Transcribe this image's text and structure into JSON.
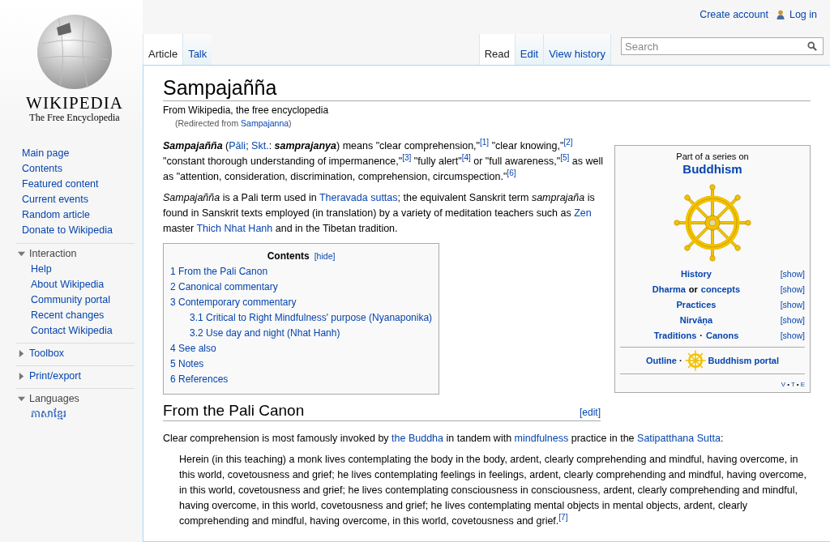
{
  "personal": {
    "create_account": "Create account",
    "log_in": "Log in"
  },
  "logo": {
    "wordmark": "WIKIPEDIA",
    "tagline": "The Free Encyclopedia"
  },
  "nav": [
    "Main page",
    "Contents",
    "Featured content",
    "Current events",
    "Random article",
    "Donate to Wikipedia"
  ],
  "portals": [
    {
      "title": "Interaction",
      "expanded": true,
      "items": [
        "Help",
        "About Wikipedia",
        "Community portal",
        "Recent changes",
        "Contact Wikipedia"
      ]
    },
    {
      "title": "Toolbox",
      "expanded": false
    },
    {
      "title": "Print/export",
      "expanded": false
    },
    {
      "title": "Languages",
      "expanded": true,
      "items": [
        "ភាសាខ្មែរ"
      ]
    }
  ],
  "tabs_left": [
    {
      "label": "Article",
      "selected": true
    },
    {
      "label": "Talk",
      "selected": false
    }
  ],
  "tabs_right": [
    {
      "label": "Read",
      "selected": true
    },
    {
      "label": "Edit",
      "selected": false
    },
    {
      "label": "View history",
      "selected": false
    }
  ],
  "search": {
    "placeholder": "Search"
  },
  "article": {
    "title": "Sampajañña",
    "tagline": "From Wikipedia, the free encyclopedia",
    "redirect": {
      "prefix": "(Redirected from ",
      "link": "Sampajanna",
      "suffix": ")"
    },
    "intro": [
      [
        {
          "kind": "bolditalic",
          "text": "Sampajañña"
        },
        {
          "kind": "text",
          "text": " ("
        },
        {
          "kind": "link",
          "text": "Pāli"
        },
        {
          "kind": "text",
          "text": "; "
        },
        {
          "kind": "link",
          "text": "Skt."
        },
        {
          "kind": "text",
          "text": ": "
        },
        {
          "kind": "bolditalic",
          "text": "samprajanya"
        },
        {
          "kind": "text",
          "text": ") means \"clear comprehension,\""
        },
        {
          "kind": "ref",
          "text": "[1]"
        },
        {
          "kind": "text",
          "text": " \"clear knowing,\""
        },
        {
          "kind": "ref",
          "text": "[2]"
        },
        {
          "kind": "text",
          "text": " \"constant thorough understanding of impermanence,\""
        },
        {
          "kind": "ref",
          "text": "[3]"
        },
        {
          "kind": "text",
          "text": " \"fully alert\""
        },
        {
          "kind": "ref",
          "text": "[4]"
        },
        {
          "kind": "text",
          "text": " or \"full awareness,\""
        },
        {
          "kind": "ref",
          "text": "[5]"
        },
        {
          "kind": "text",
          "text": " as well as \"attention, consideration, discrimination, comprehension, circumspection.\""
        },
        {
          "kind": "ref",
          "text": "[6]"
        }
      ],
      [
        {
          "kind": "italic",
          "text": "Sampajañña"
        },
        {
          "kind": "text",
          "text": " is a Pali term used in "
        },
        {
          "kind": "link",
          "text": "Theravada suttas"
        },
        {
          "kind": "text",
          "text": "; the equivalent Sanskrit term "
        },
        {
          "kind": "italic",
          "text": "samprajaña"
        },
        {
          "kind": "text",
          "text": " is found in Sanskrit texts employed (in translation) by a variety of meditation teachers such as "
        },
        {
          "kind": "link",
          "text": "Zen"
        },
        {
          "kind": "text",
          "text": " master "
        },
        {
          "kind": "link",
          "text": "Thich Nhat Hanh"
        },
        {
          "kind": "text",
          "text": " and in the Tibetan tradition."
        }
      ]
    ],
    "toc": {
      "title": "Contents",
      "toggle": "[hide]",
      "items": [
        {
          "number": "1",
          "label": "From the Pali Canon"
        },
        {
          "number": "2",
          "label": "Canonical commentary"
        },
        {
          "number": "3",
          "label": "Contemporary commentary",
          "children": [
            {
              "number": "3.1",
              "label": "Critical to Right Mindfulness' purpose (Nyanaponika)"
            },
            {
              "number": "3.2",
              "label": "Use day and night (Nhat Hanh)"
            }
          ]
        },
        {
          "number": "4",
          "label": "See also"
        },
        {
          "number": "5",
          "label": "Notes"
        },
        {
          "number": "6",
          "label": "References"
        }
      ]
    },
    "section": {
      "heading": "From the Pali Canon",
      "edit": "[edit]",
      "paragraph": [
        {
          "kind": "text",
          "text": "Clear comprehension is most famously invoked by "
        },
        {
          "kind": "link",
          "text": "the Buddha"
        },
        {
          "kind": "text",
          "text": " in tandem with "
        },
        {
          "kind": "link",
          "text": "mindfulness"
        },
        {
          "kind": "text",
          "text": " practice in the "
        },
        {
          "kind": "link",
          "text": "Satipatthana Sutta"
        },
        {
          "kind": "text",
          "text": ":"
        }
      ],
      "quote": [
        {
          "kind": "text",
          "text": "Herein (in this teaching) a monk lives contemplating the body in the body, ardent, clearly comprehending and mindful, having overcome, in this world, covetousness and grief; he lives contemplating feelings in feelings, ardent, clearly comprehending and mindful, having overcome, in this world, covetousness and grief; he lives contemplating consciousness in consciousness, ardent, clearly comprehending and mindful, having overcome, in this world, covetousness and grief; he lives contemplating mental objects in mental objects, ardent, clearly comprehending and mindful, having overcome, in this world, covetousness and grief."
        },
        {
          "kind": "ref",
          "text": "[7]"
        }
      ]
    }
  },
  "infobox": {
    "pretitle": "Part of a series on",
    "title": "Buddhism",
    "rows": [
      {
        "parts": [
          {
            "kind": "link",
            "text": "History"
          }
        ],
        "toggle": "[show]"
      },
      {
        "parts": [
          {
            "kind": "link",
            "text": "Dharma"
          },
          {
            "kind": "text",
            "text": "or"
          },
          {
            "kind": "link",
            "text": "concepts"
          }
        ],
        "toggle": "[show]"
      },
      {
        "parts": [
          {
            "kind": "link",
            "text": "Practices"
          }
        ],
        "toggle": "[show]"
      },
      {
        "parts": [
          {
            "kind": "link",
            "text": "Nirvāṇa"
          }
        ],
        "toggle": "[show]"
      },
      {
        "parts": [
          {
            "kind": "link",
            "text": "Traditions"
          },
          {
            "kind": "text",
            "text": "·"
          },
          {
            "kind": "link",
            "text": "Canons"
          }
        ],
        "toggle": "[show]"
      }
    ],
    "outline": "Outline",
    "separator": "·",
    "portal": "Buddhism portal",
    "vte": [
      "V",
      "T",
      "E"
    ],
    "vte_separator": "•"
  }
}
